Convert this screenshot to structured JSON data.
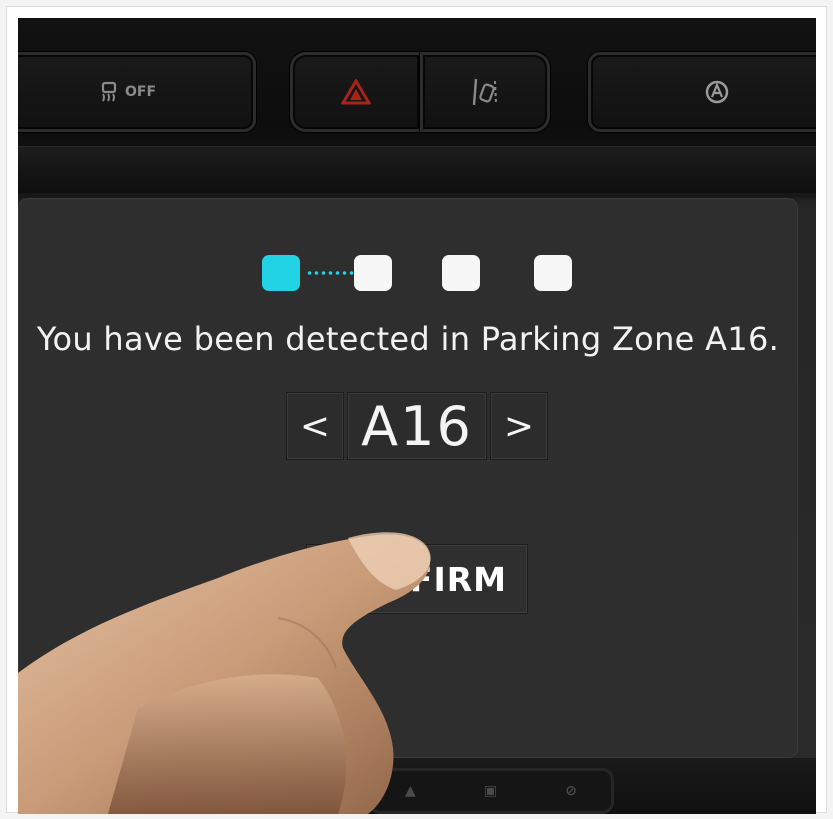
{
  "hardware_buttons": {
    "traction_off_label": "OFF",
    "traction_off_icon": "traction-control-off-icon",
    "hazard_icon": "hazard-warning-icon",
    "lane_assist_icon": "lane-departure-icon",
    "auto_start_stop_icon": "auto-start-stop-icon"
  },
  "progress": {
    "total_steps": 4,
    "current_step": 1,
    "active_color": "#22d3e6",
    "inactive_color": "#f7f7f7"
  },
  "message": "You have been detected in Parking Zone A16.",
  "zone_picker": {
    "prev_glyph": "<",
    "value": "A16",
    "next_glyph": ">"
  },
  "confirm_button": {
    "label": "CONFIRM"
  },
  "colors": {
    "screen_background": "#2e2e2e",
    "text": "#f2f2f2",
    "accent": "#22d3e6"
  }
}
